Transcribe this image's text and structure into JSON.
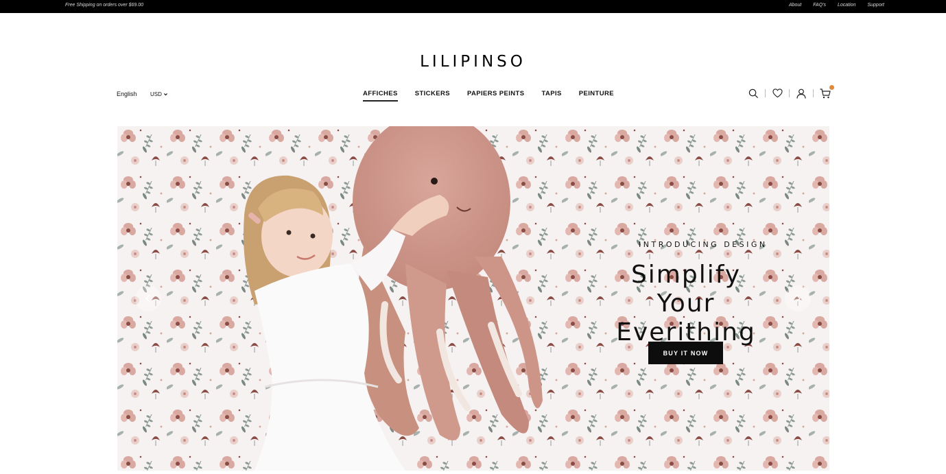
{
  "topbar": {
    "promo": "Free Shipping on orders over $69.00",
    "links": [
      "About",
      "FAQ's",
      "Location",
      "Support"
    ]
  },
  "logo": "LILIPINSO",
  "header": {
    "language": "English",
    "currency": "USD"
  },
  "nav": {
    "items": [
      "AFFICHES",
      "STICKERS",
      "PAPIERS PEINTS",
      "TAPIS",
      "PEINTURE"
    ],
    "active": "AFFICHES"
  },
  "icons": [
    "search-icon",
    "heart-icon",
    "user-icon",
    "cart-icon"
  ],
  "hero": {
    "eyebrow": "INTRODUCING DESIGN",
    "headline_line1": "Simplify Your",
    "headline_line2": "Everithing",
    "cta": "BUY IT NOW"
  },
  "colors": {
    "topbar_bg": "#000000",
    "cart_badge": "#e08a3c",
    "cta_bg": "#0d0d0d",
    "hero_bg": "#f7f2f2",
    "flower_pink": "#d9a9a1",
    "flower_brown": "#8a4d45",
    "leaf_gray": "#8c9a96"
  }
}
